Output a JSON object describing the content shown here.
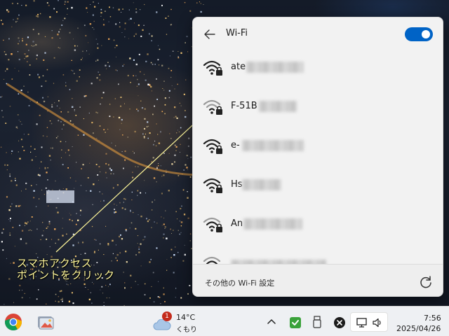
{
  "flyout": {
    "title": "Wi-Fi",
    "toggle_on": true,
    "networks": [
      {
        "ssid": "ate",
        "secured": true
      },
      {
        "ssid": "F-51B",
        "secured": true,
        "highlighted": true
      },
      {
        "ssid": "e-",
        "secured": true
      },
      {
        "ssid": "Hs",
        "secured": true
      },
      {
        "ssid": "An",
        "secured": true
      },
      {
        "ssid": "",
        "secured": true
      }
    ],
    "footer_link": "その他の Wi-Fi 設定"
  },
  "annotation": {
    "line1": "スマホアクセス",
    "line2": "ポイントをクリック",
    "color": "#fff79a"
  },
  "taskbar": {
    "weather": {
      "badge": "1",
      "temperature": "14°C",
      "condition": "くもり"
    },
    "clock": {
      "time": "7:56",
      "date": "2025/04/26"
    }
  },
  "colors": {
    "accent": "#0063c6",
    "flyout_bg": "#f2f2f2",
    "taskbar_bg": "#eef0f3"
  }
}
